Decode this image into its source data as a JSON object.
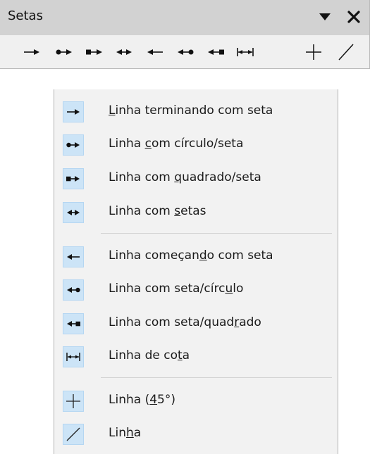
{
  "toolbar": {
    "title": "Setas",
    "dropdown_icon": "triangle-down-icon",
    "close_icon": "close-icon",
    "tools": [
      {
        "name": "line-ends-with-arrow-icon"
      },
      {
        "name": "line-circle-arrow-icon"
      },
      {
        "name": "line-square-arrow-icon"
      },
      {
        "name": "line-arrows-icon"
      },
      {
        "name": "line-starts-with-arrow-icon"
      },
      {
        "name": "line-arrow-circle-icon"
      },
      {
        "name": "line-arrow-square-icon"
      },
      {
        "name": "dimension-line-icon"
      },
      {
        "name": "line-45-icon"
      },
      {
        "name": "line-icon"
      }
    ]
  },
  "menu": {
    "items": [
      {
        "pre": "",
        "ul": "L",
        "post": "inha terminando com seta"
      },
      {
        "pre": "Linha ",
        "ul": "c",
        "post": "om círculo/seta"
      },
      {
        "pre": "Linha com ",
        "ul": "q",
        "post": "uadrado/seta"
      },
      {
        "pre": "Linha com ",
        "ul": "s",
        "post": "etas"
      },
      {
        "pre": "Linha começan",
        "ul": "d",
        "post": "o com seta"
      },
      {
        "pre": "Linha com seta/círc",
        "ul": "u",
        "post": "lo"
      },
      {
        "pre": "Linha com seta/quad",
        "ul": "r",
        "post": "ado"
      },
      {
        "pre": "Linha de co",
        "ul": "t",
        "post": "a"
      },
      {
        "pre": "Linha (",
        "ul": "4",
        "post": "5°)"
      },
      {
        "pre": "Lin",
        "ul": "h",
        "post": "a"
      }
    ]
  }
}
